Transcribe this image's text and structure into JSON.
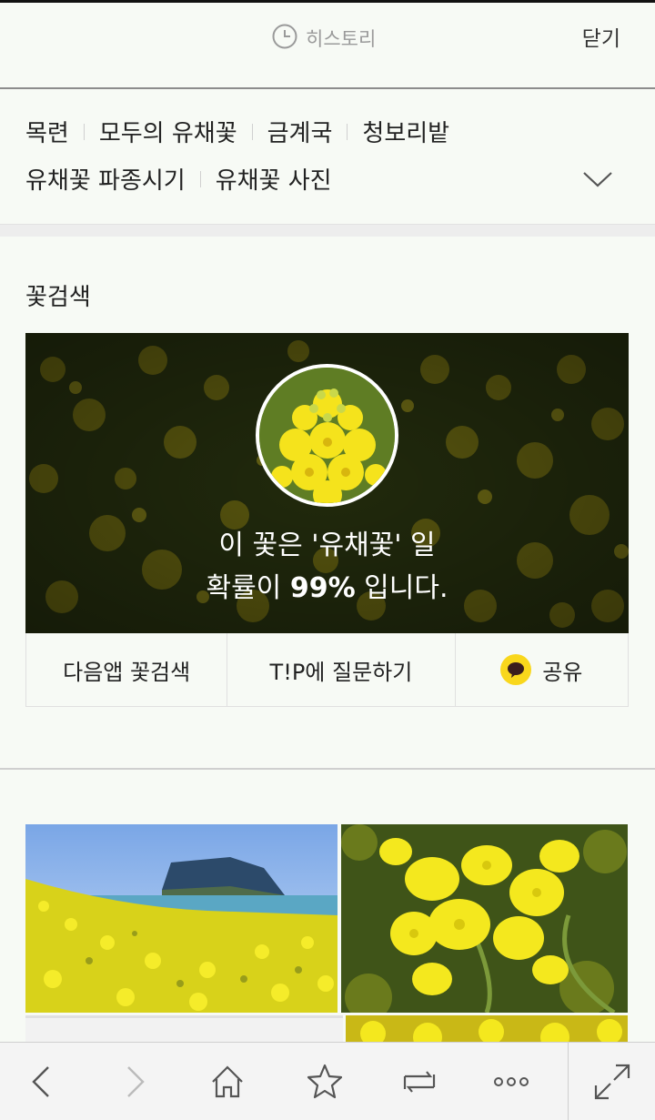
{
  "header": {
    "history_label": "히스토리",
    "close_label": "닫기"
  },
  "tags": {
    "row1": [
      "목련",
      "모두의 유채꽃",
      "금계국",
      "청보리밭"
    ],
    "row2": [
      "유채꽃 파종시기",
      "유채꽃 사진"
    ]
  },
  "section": {
    "title": "꽃검색",
    "result_line1": "이 꽃은 '유채꽃' 일",
    "result_line2_pre": "확률이 ",
    "result_percent": "99%",
    "result_line2_post": " 입니다."
  },
  "actions": {
    "daum_flower_search": "다음앱 꽃검색",
    "tip_question": "T!P에 질문하기",
    "share": "공유"
  },
  "icons": {
    "history": "clock-icon",
    "expand": "chevron-down-icon",
    "share": "kakao-talk-icon",
    "back": "back-arrow-icon",
    "forward": "forward-arrow-icon",
    "home": "home-icon",
    "bookmark": "star-icon",
    "tabs": "tabs-switch-icon",
    "more": "more-dots-icon",
    "fullscreen": "fullscreen-icon"
  },
  "colors": {
    "background": "#f7faf5",
    "flower_yellow": "#f2e21a",
    "kakao_yellow": "#f9d71c"
  }
}
